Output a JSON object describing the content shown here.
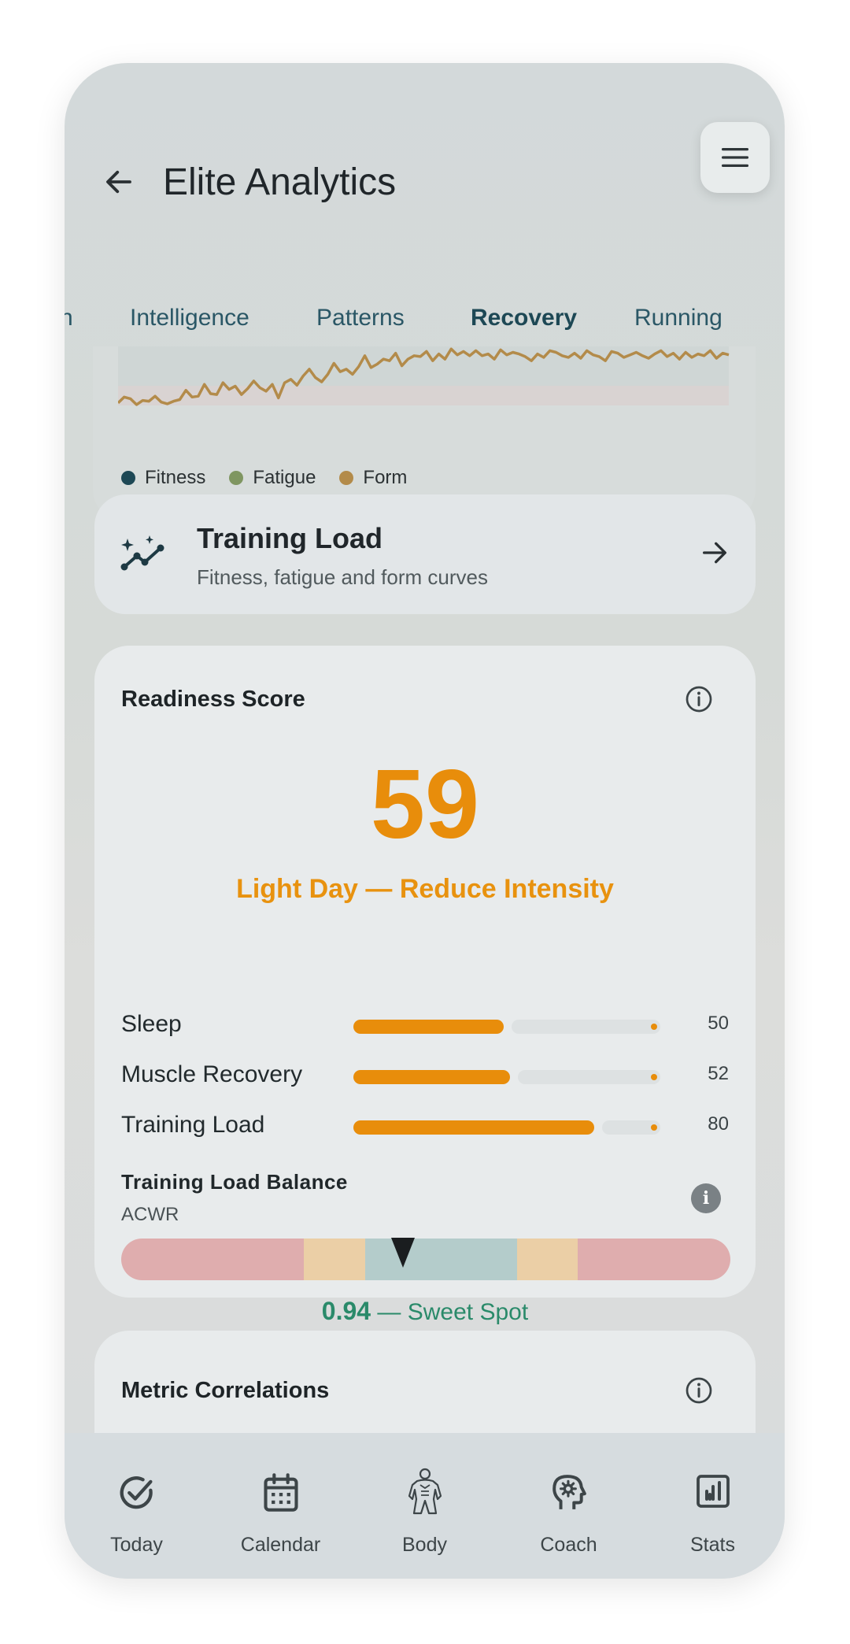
{
  "app": {
    "title": "Elite Analytics"
  },
  "tabs": [
    {
      "label": "n"
    },
    {
      "label": "Intelligence"
    },
    {
      "label": "Patterns"
    },
    {
      "label": "Recovery",
      "active": true
    },
    {
      "label": "Running"
    }
  ],
  "chart_data": {
    "type": "line",
    "series": [
      {
        "name": "Fitness",
        "color": "#1d4855"
      },
      {
        "name": "Fatigue",
        "color": "#7f9661"
      },
      {
        "name": "Form",
        "color": "#b38b4a",
        "values": [
          -12,
          -5,
          -7,
          -14,
          -9,
          -10,
          -4,
          -11,
          -13,
          -10,
          -8,
          3,
          -5,
          -4,
          10,
          -1,
          -2,
          12,
          4,
          8,
          -2,
          5,
          14,
          6,
          2,
          10,
          -6,
          12,
          16,
          9,
          20,
          28,
          18,
          13,
          22,
          35,
          25,
          28,
          22,
          31,
          44,
          30,
          34,
          40,
          38,
          47,
          32,
          40,
          44,
          43,
          49,
          38,
          46,
          40,
          52,
          45,
          49,
          44,
          50,
          44,
          46,
          40,
          51,
          45,
          48,
          46,
          43,
          38,
          46,
          42,
          50,
          48,
          44,
          42,
          47,
          41,
          50,
          45,
          43,
          38,
          49,
          47,
          42,
          45,
          48,
          44,
          41,
          46,
          50,
          43,
          47,
          40,
          48,
          42,
          46,
          44,
          50,
          41,
          47,
          45
        ]
      }
    ]
  },
  "legend": [
    {
      "label": "Fitness",
      "color": "#1d4855"
    },
    {
      "label": "Fatigue",
      "color": "#7f9661"
    },
    {
      "label": "Form",
      "color": "#b38b4a"
    }
  ],
  "training_load_card": {
    "title": "Training Load",
    "subtitle": "Fitness, fatigue and form curves",
    "icon": "sparkle-trend-icon"
  },
  "readiness": {
    "title": "Readiness Score",
    "score": "59",
    "verdict": "Light Day — Reduce Intensity",
    "accent_color": "#e88d0b",
    "metrics": [
      {
        "label": "Sleep",
        "value": "50",
        "level": 0.5
      },
      {
        "label": "Muscle Recovery",
        "value": "52",
        "level": 0.52
      },
      {
        "label": "Training Load",
        "value": "80",
        "level": 0.8
      }
    ],
    "balance": {
      "title": "Training Load Balance",
      "subtitle": "ACWR",
      "info_glyph": "i",
      "value": "0.94",
      "zone": "— Sweet Spot",
      "zone_colors": [
        "#dfadae",
        "#ebcfa6",
        "#b4cccb",
        "#ebcfa6",
        "#dfadae"
      ]
    }
  },
  "correlations": {
    "title": "Metric Correlations"
  },
  "bottom_nav": [
    {
      "label": "Today",
      "icon": "check-circle-icon"
    },
    {
      "label": "Calendar",
      "icon": "calendar-icon"
    },
    {
      "label": "Body",
      "icon": "body-muscle-icon"
    },
    {
      "label": "Coach",
      "icon": "brain-head-icon"
    },
    {
      "label": "Stats",
      "icon": "bar-chart-icon"
    }
  ]
}
